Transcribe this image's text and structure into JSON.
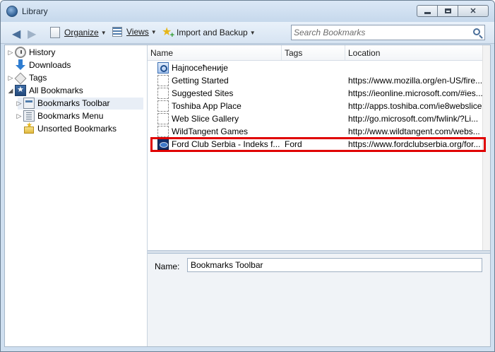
{
  "window": {
    "title": "Library"
  },
  "toolbar": {
    "organize_label": "Organize",
    "views_label": "Views",
    "import_label": "Import and Backup"
  },
  "search": {
    "placeholder": "Search Bookmarks"
  },
  "sidebar": {
    "items": [
      {
        "label": "History",
        "icon": "history-icon"
      },
      {
        "label": "Downloads",
        "icon": "download-icon"
      },
      {
        "label": "Tags",
        "icon": "tag-icon"
      },
      {
        "label": "All Bookmarks",
        "icon": "all-bookmarks-icon"
      },
      {
        "label": "Bookmarks Toolbar",
        "icon": "bookmarks-toolbar-icon",
        "selected": true
      },
      {
        "label": "Bookmarks Menu",
        "icon": "bookmarks-menu-icon"
      },
      {
        "label": "Unsorted Bookmarks",
        "icon": "unsorted-bookmarks-icon"
      }
    ]
  },
  "list": {
    "columns": [
      "Name",
      "Tags",
      "Location"
    ],
    "rows": [
      {
        "name": "Најпосећеније",
        "tags": "",
        "location": "",
        "icon": "smart-query-icon"
      },
      {
        "name": "Getting Started",
        "tags": "",
        "location": "https://www.mozilla.org/en-US/fire...",
        "icon": "blank-page-icon"
      },
      {
        "name": "Suggested Sites",
        "tags": "",
        "location": "https://ieonline.microsoft.com/#ies...",
        "icon": "blank-page-icon"
      },
      {
        "name": "Toshiba App Place",
        "tags": "",
        "location": "http://apps.toshiba.com/ie8webslice",
        "icon": "blank-page-icon"
      },
      {
        "name": "Web Slice Gallery",
        "tags": "",
        "location": "http://go.microsoft.com/fwlink/?Li...",
        "icon": "blank-page-icon"
      },
      {
        "name": "WildTangent Games",
        "tags": "",
        "location": "http://www.wildtangent.com/webs...",
        "icon": "blank-page-icon"
      },
      {
        "name": "Ford Club Serbia - Indeks f...",
        "tags": "Ford",
        "location": "https://www.fordclubserbia.org/for...",
        "icon": "ford-favicon-icon",
        "highlighted": true
      }
    ]
  },
  "details": {
    "name_label": "Name:",
    "name_value": "Bookmarks Toolbar"
  },
  "colors": {
    "highlight_border": "#e00000",
    "accent": "#2f5f95"
  }
}
